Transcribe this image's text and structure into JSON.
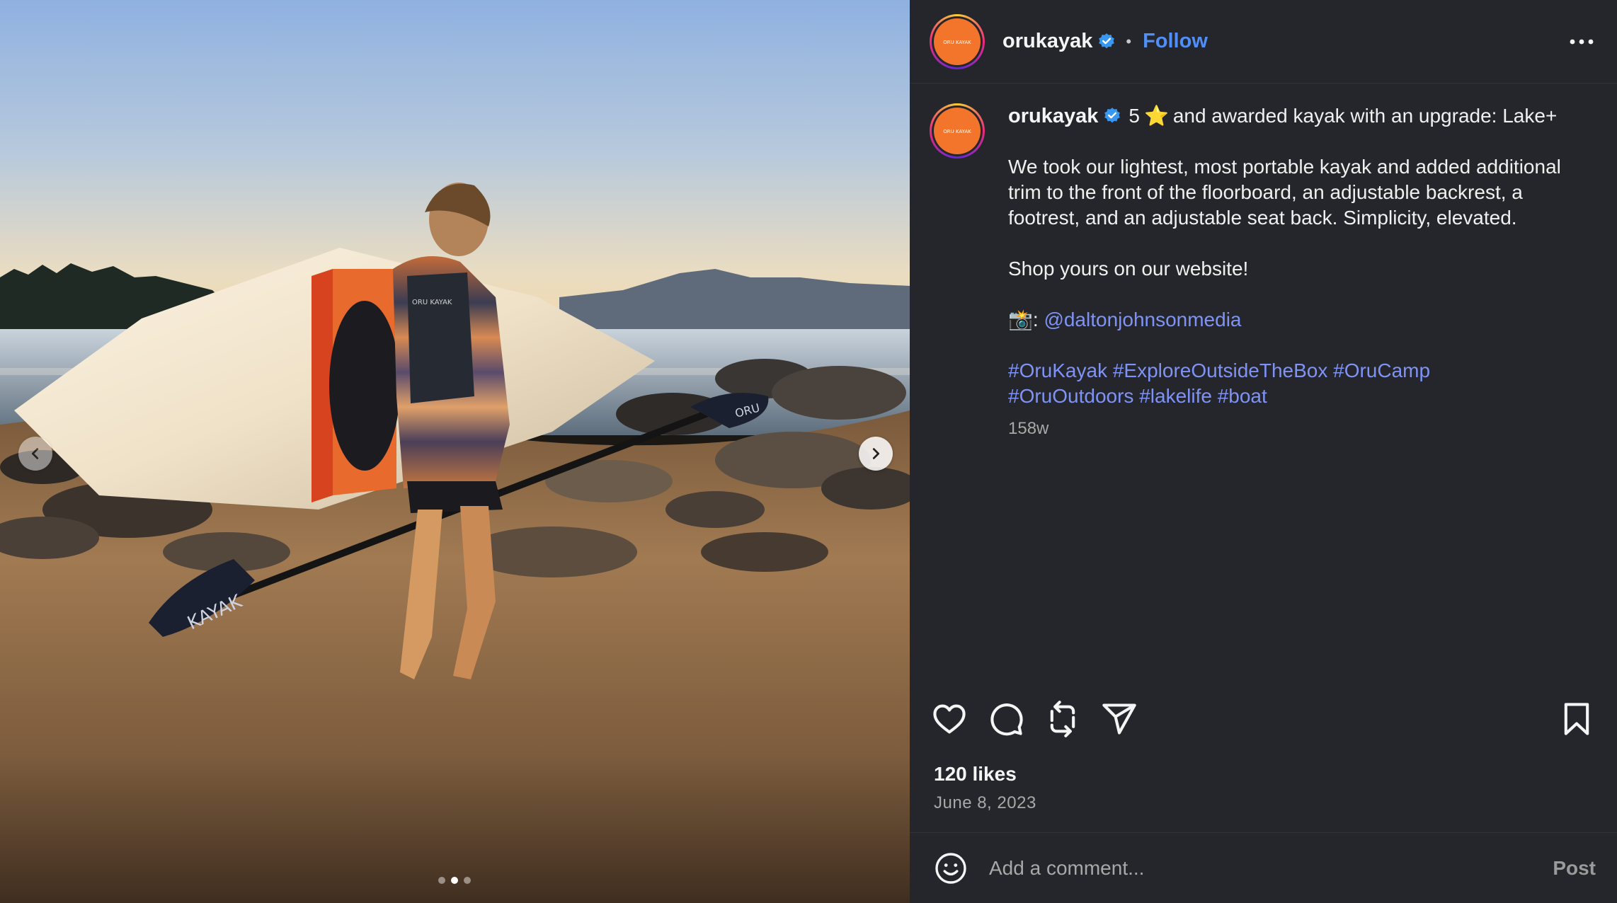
{
  "post": {
    "author": {
      "username": "orukayak",
      "verified": true,
      "avatar_text": "ORU KAYAK",
      "avatar_color": "#f3742b"
    },
    "header": {
      "separator": "•",
      "follow_label": "Follow",
      "more_icon": "more-options-icon"
    },
    "media": {
      "carousel_dots": 3,
      "active_index": 1,
      "kayak_text": "KAYAK",
      "paddle_text": "ORU",
      "vest_text": "ORU KAYAK",
      "prev_icon": "chevron-left-icon",
      "next_icon": "chevron-right-icon"
    },
    "caption": {
      "rating_number": "5",
      "star": "⭐",
      "first_line": "and awarded kayak with an upgrade: Lake+",
      "paragraph_1": "We took our lightest, most portable kayak and added additional trim to the front of the floorboard, an adjustable backrest, a footrest, and an adjustable seat back. Simplicity, elevated.",
      "paragraph_2": "Shop yours on our website!",
      "photo_credit_prefix": "📸:",
      "photo_credit_handle": "@daltonjohnsonmedia",
      "hashtags_line_1": "#OruKayak #ExploreOutsideTheBox #OruCamp",
      "hashtags_line_2": "#OruOutdoors #lakelife #boat",
      "age": "158w"
    },
    "actions": {
      "icons": [
        "heart-icon",
        "comment-icon",
        "repost-icon",
        "share-icon",
        "bookmark-icon"
      ]
    },
    "likes": "120 likes",
    "date": "June 8, 2023",
    "comment_box": {
      "placeholder": "Add a comment...",
      "post_label": "Post",
      "emoji_icon": "emoji-icon"
    },
    "colors": {
      "panel_bg": "#25262b",
      "link": "#7f93f5",
      "follow": "#4f8ff7",
      "verified": "#3897f0"
    }
  }
}
